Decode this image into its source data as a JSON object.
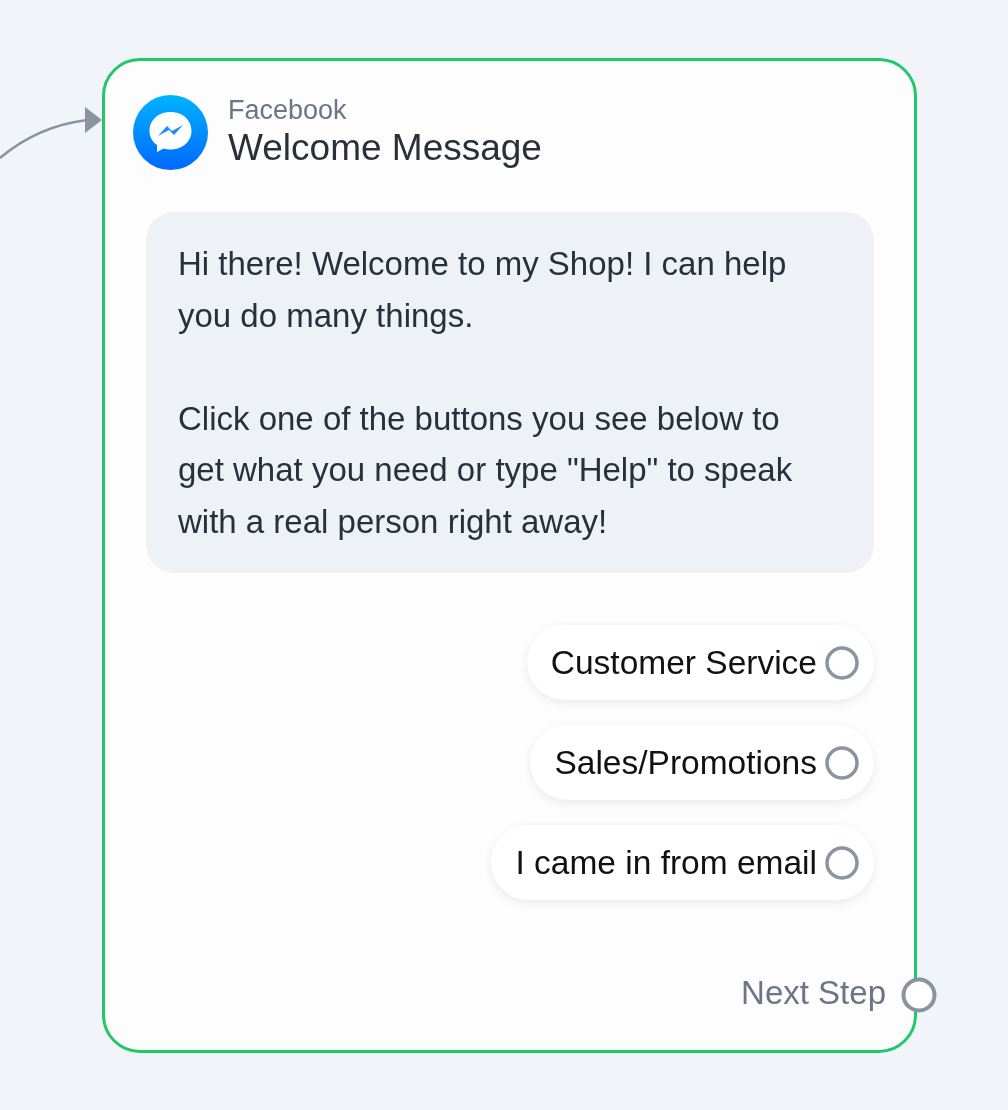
{
  "node": {
    "channel": "Facebook",
    "title": "Welcome Message"
  },
  "message": {
    "paragraphs": [
      "Hi there! Welcome to my Shop! I can help you do many things.",
      "Click one of the buttons you see below to get what you need or type \"Help\" to speak with a real person right away!"
    ]
  },
  "buttons": [
    {
      "label": "Customer Service"
    },
    {
      "label": "Sales/Promotions"
    },
    {
      "label": "I came in from email"
    }
  ],
  "next_step": {
    "label": "Next Step"
  }
}
